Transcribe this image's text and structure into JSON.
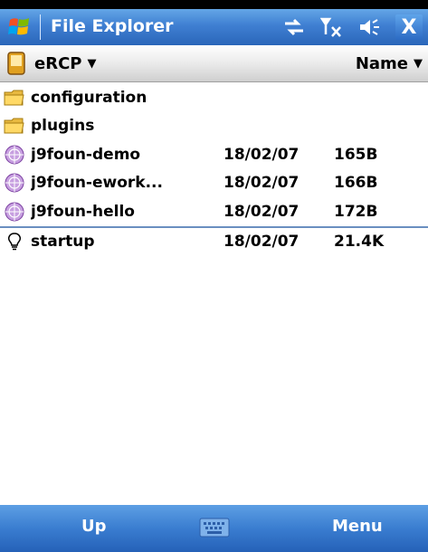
{
  "titlebar": {
    "title": "File Explorer",
    "close_label": "X",
    "status_icons": [
      "connectivity-icon",
      "signal-off-icon",
      "volume-icon"
    ]
  },
  "folderbar": {
    "folder": "eRCP",
    "sort": "Name"
  },
  "files": [
    {
      "name": "configuration",
      "date": "",
      "size": "",
      "icon": "folder-icon"
    },
    {
      "name": "plugins",
      "date": "",
      "size": "",
      "icon": "folder-icon"
    },
    {
      "name": "j9foun-demo",
      "date": "18/02/07",
      "size": "165B",
      "icon": "globe-file-icon"
    },
    {
      "name": "j9foun-ework...",
      "date": "18/02/07",
      "size": "166B",
      "icon": "globe-file-icon"
    },
    {
      "name": "j9foun-hello",
      "date": "18/02/07",
      "size": "172B",
      "icon": "globe-file-icon"
    },
    {
      "name": "startup",
      "date": "18/02/07",
      "size": "21.4K",
      "icon": "bulb-icon"
    }
  ],
  "softkeys": {
    "left": "Up",
    "right": "Menu"
  },
  "colors": {
    "titlebar": "#3f7fd2",
    "softbar": "#3a7dd0",
    "divider": "#6a8fc0"
  }
}
